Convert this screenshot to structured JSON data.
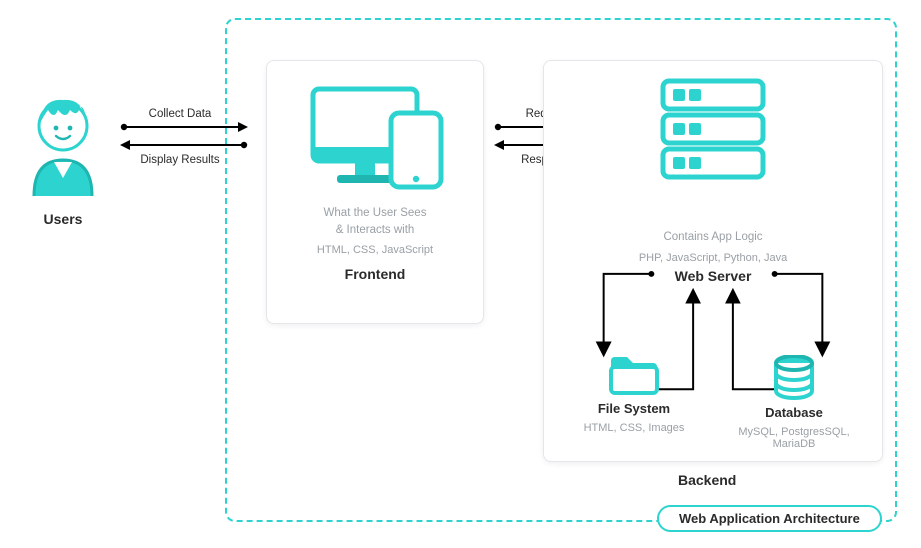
{
  "diagram_title": "Web Application Architecture",
  "users": {
    "label": "Users"
  },
  "arrows": {
    "collect": "Collect Data",
    "display": "Display Results",
    "request": "Request",
    "response": "Response"
  },
  "frontend": {
    "desc_line1": "What the User Sees",
    "desc_line2": "& Interacts with",
    "tech": "HTML, CSS, JavaScript",
    "title": "Frontend"
  },
  "backend": {
    "app_logic": "Contains App Logic",
    "app_tech": "PHP, JavaScript, Python, Java",
    "web_server": "Web Server",
    "file_system": {
      "title": "File System",
      "tech": "HTML, CSS, Images"
    },
    "database": {
      "title": "Database",
      "tech": "MySQL, PostgresSQL, MariaDB"
    },
    "label": "Backend"
  },
  "colors": {
    "teal": "#2dd4cf",
    "teal_dark": "#1fb6b1"
  }
}
